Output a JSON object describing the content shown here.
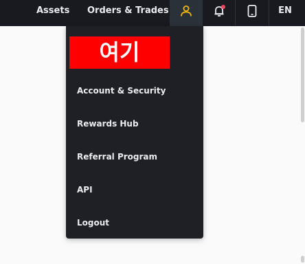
{
  "topbar": {
    "nav": {
      "assets": "Assets",
      "orders_trades": "Orders & Trades"
    },
    "icons": {
      "user": "user-icon",
      "bell": "bell-icon",
      "phone": "phone-icon"
    },
    "language": "EN"
  },
  "dropdown": {
    "highlight_text": "여기",
    "items": [
      {
        "label": "Account & Security"
      },
      {
        "label": "Rewards Hub"
      },
      {
        "label": "Referral Program"
      },
      {
        "label": "API"
      },
      {
        "label": "Logout"
      }
    ]
  },
  "colors": {
    "topbar_bg": "#181a20",
    "dropdown_bg": "#1e2026",
    "accent": "#f0b90b",
    "highlight": "#ff0000",
    "notification_dot": "#f6465d"
  }
}
